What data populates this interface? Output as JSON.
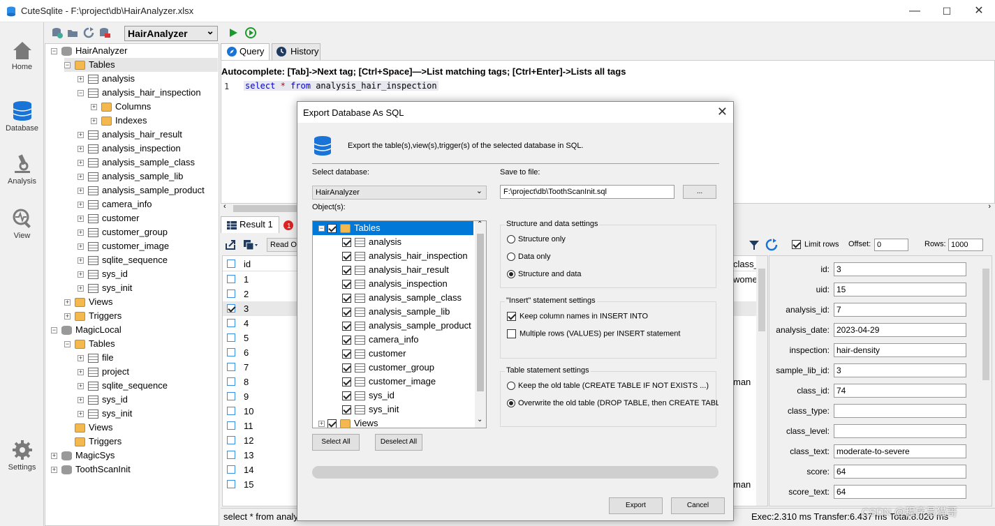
{
  "window": {
    "title": "CuteSqlite - F:\\project\\db\\HairAnalyzer.xlsx",
    "minimize": "—",
    "maximize": "☐",
    "close": "✕"
  },
  "nav": [
    {
      "label": "Home"
    },
    {
      "label": "Database"
    },
    {
      "label": "Analysis"
    },
    {
      "label": "View"
    },
    {
      "label": "Settings"
    }
  ],
  "toolbar": {
    "db_select": "HairAnalyzer",
    "chevron": "⌄"
  },
  "tree": {
    "db1": "HairAnalyzer",
    "db1_tables": "Tables",
    "db1_items": [
      "analysis",
      "analysis_hair_inspection",
      "Columns",
      "Indexes",
      "analysis_hair_result",
      "analysis_inspection",
      "analysis_sample_class",
      "analysis_sample_lib",
      "analysis_sample_product",
      "camera_info",
      "customer",
      "customer_group",
      "customer_image",
      "sqlite_sequence",
      "sys_id",
      "sys_init"
    ],
    "db1_views": "Views",
    "db1_triggers": "Triggers",
    "db2": "MagicLocal",
    "db2_tables": "Tables",
    "db2_items": [
      "file",
      "project",
      "sqlite_sequence",
      "sys_id",
      "sys_init"
    ],
    "db2_views": "Views",
    "db2_triggers": "Triggers",
    "db3": "MagicSys",
    "db4": "ToothScanInit"
  },
  "query": {
    "tab_query": "Query",
    "tab_history": "History",
    "hint": "Autocomplete: [Tab]->Next tag; [Ctrl+Space]—>List matching tags; [Ctrl+Enter]->Lists all tags",
    "line": "1",
    "sql_kw1": "select",
    "sql_op": "*",
    "sql_kw2": "from",
    "sql_table": "analysis_hair_inspection"
  },
  "result": {
    "tab": "Result 1",
    "read_only": "Read On",
    "limit_rows": "Limit rows",
    "offset_label": "Offset:",
    "offset_value": "0",
    "rows_label": "Rows:",
    "rows_value": "1000",
    "col_id": "id",
    "col_class": "class_",
    "ids": [
      "1",
      "2",
      "3",
      "4",
      "5",
      "6",
      "7",
      "8",
      "9",
      "10",
      "11",
      "12",
      "13",
      "14",
      "15"
    ],
    "row1_class": "wome",
    "row8_class": "man",
    "row15_class": "man",
    "status_sql": "select * from analy",
    "status_exec": "Exec:2.310 ms Transfer:6.437 ms Total:8.020 ms"
  },
  "detail": [
    {
      "label": "id:",
      "value": "3"
    },
    {
      "label": "uid:",
      "value": "15"
    },
    {
      "label": "analysis_id:",
      "value": "7"
    },
    {
      "label": "analysis_date:",
      "value": "2023-04-29"
    },
    {
      "label": "inspection:",
      "value": "hair-density"
    },
    {
      "label": "sample_lib_id:",
      "value": "3"
    },
    {
      "label": "class_id:",
      "value": "74"
    },
    {
      "label": "class_type:",
      "value": ""
    },
    {
      "label": "class_level:",
      "value": ""
    },
    {
      "label": "class_text:",
      "value": "moderate-to-severe"
    },
    {
      "label": "score:",
      "value": "64"
    },
    {
      "label": "score_text:",
      "value": "64"
    }
  ],
  "dialog": {
    "title": "Export Database As SQL",
    "description": "Export the table(s),view(s),trigger(s) of the selected database in SQL.",
    "select_db_label": "Select database:",
    "select_db_value": "HairAnalyzer",
    "save_label": "Save to file:",
    "save_value": "F:\\project\\db\\ToothScanInit.sql",
    "browse": "...",
    "objects_label": "Object(s):",
    "objects_root": "Tables",
    "objects": [
      "analysis",
      "analysis_hair_inspection",
      "analysis_hair_result",
      "analysis_inspection",
      "analysis_sample_class",
      "analysis_sample_lib",
      "analysis_sample_product",
      "camera_info",
      "customer",
      "customer_group",
      "customer_image",
      "sys_id",
      "sys_init"
    ],
    "objects_views": "Views",
    "select_all": "Select All",
    "deselect_all": "Deselect All",
    "structure_group": "Structure and data settings",
    "structure_only": "Structure only",
    "data_only": "Data only",
    "structure_and_data": "Structure and data",
    "insert_group": "\"Insert\" statement settings",
    "keep_columns": "Keep column names in INSERT INTO",
    "multiple_rows": "Multiple rows (VALUES) per INSERT statement",
    "table_group": "Table statement settings",
    "keep_old": "Keep the old table (CREATE TABLE IF NOT EXISTS ...)",
    "overwrite_old": "Overwrite the old table (DROP TABLE, then CREATE TABLE",
    "export": "Export",
    "cancel": "Cancel"
  },
  "watermark": "CSDN @程序员猫哥"
}
